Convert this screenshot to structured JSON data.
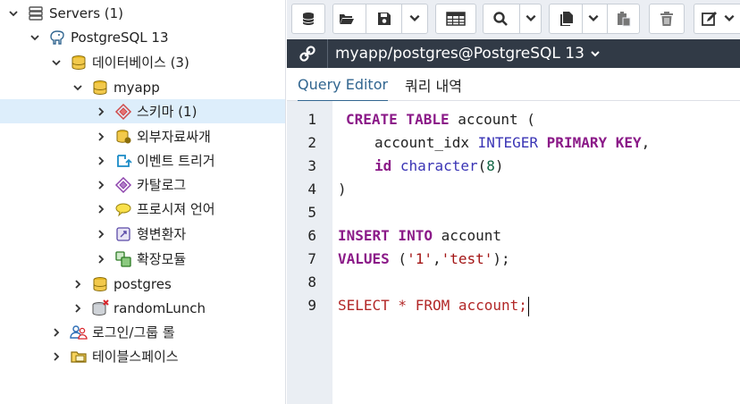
{
  "tree": {
    "servers": "Servers (1)",
    "server": "PostgreSQL 13",
    "databases": "데이터베이스 (3)",
    "db_myapp": "myapp",
    "schemas": "스키마 (1)",
    "fdw": "외부자료싸개",
    "event_triggers": "이벤트 트리거",
    "catalogs": "카탈로그",
    "languages": "프로시져 언어",
    "casts": "형변환자",
    "extensions": "확장모듈",
    "db_postgres": "postgres",
    "db_random": "randomLunch",
    "login_roles": "로그인/그룹 롤",
    "tablespaces": "테이블스페이스"
  },
  "connection": {
    "title": "myapp/postgres@PostgreSQL 13"
  },
  "tabs": {
    "query_editor": "Query Editor",
    "query_history": "쿼리 내역"
  },
  "editor": {
    "line_numbers": [
      "1",
      "2",
      "3",
      "4",
      "5",
      "6",
      "7",
      "8",
      "9"
    ],
    "l1_kw": "CREATE TABLE",
    "l1_rest": " account (",
    "l2_ident": "account_idx ",
    "l2_type": "INTEGER",
    "l2_kw": "PRIMARY KEY",
    "l2_comma": ",",
    "l3_ident": "id",
    "l3_type": "character",
    "l3_open": "(",
    "l3_num": "8",
    "l3_close": ")",
    "l4": ")",
    "l6_kw": "INSERT INTO",
    "l6_rest": " account",
    "l7_kw": "VALUES",
    "l7_rest": " (",
    "l7_s1": "'1'",
    "l7_comma": ",",
    "l7_s2": "'test'",
    "l7_end": ");",
    "l9": "SELECT * FROM account;"
  },
  "colors": {
    "selected_row": "#ddeefb",
    "connbar": "#313a46",
    "active_tab": "#326690",
    "keyword": "#8b1a88",
    "type": "#3a34b5",
    "string": "#a31515"
  }
}
